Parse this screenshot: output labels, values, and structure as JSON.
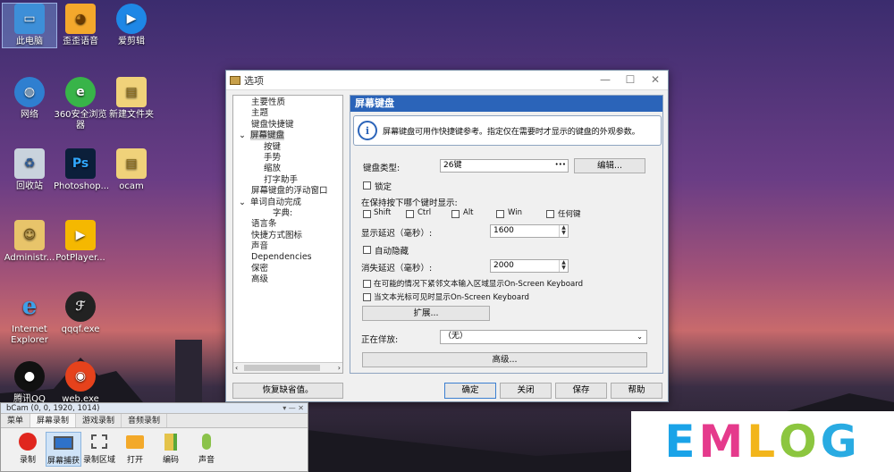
{
  "desktop": {
    "icons": [
      {
        "label": "此电脑"
      },
      {
        "label": "歪歪语音"
      },
      {
        "label": "爱剪辑"
      },
      {
        "label": "网络"
      },
      {
        "label": "360安全浏览器"
      },
      {
        "label": "新建文件夹"
      },
      {
        "label": "回收站"
      },
      {
        "label": "Photoshop..."
      },
      {
        "label": "ocam"
      },
      {
        "label": "Administr..."
      },
      {
        "label": "PotPlayer..."
      },
      {
        "label": "Internet Explorer"
      },
      {
        "label": "qqqf.exe"
      },
      {
        "label": "腾讯QQ"
      },
      {
        "label": "web.exe"
      }
    ]
  },
  "dialog": {
    "title": "选项",
    "tree": [
      "主要性质",
      "主题",
      "键盘快捷键",
      "屏幕键盘",
      "按键",
      "手势",
      "缩放",
      "打字助手",
      "屏幕键盘的浮动窗口",
      "单词自动完成",
      "字典:",
      "语言条",
      "快捷方式图标",
      "声音",
      "Dependencies",
      "保密",
      "高级"
    ],
    "panel_title": "屏幕键盘",
    "info_text": "屏幕键盘可用作快捷键参考。指定仅在需要时才显示的键盘的外观参数。",
    "keyboard_type_label": "键盘类型:",
    "keyboard_type_value": "26键",
    "ellipsis": "•••",
    "edit_button": "编辑...",
    "lock_label": "锁定",
    "hold_label": "在保持按下哪个键时显示:",
    "keys": [
      "Shift",
      "Ctrl",
      "Alt",
      "Win",
      "任何键"
    ],
    "show_delay_label": "显示延迟（毫秒）:",
    "show_delay_value": "1600",
    "auto_hide_label": "自动隐藏",
    "hide_delay_label": "消失延迟（毫秒）:",
    "hide_delay_value": "2000",
    "option1": "在可能的情况下紧邻文本输入区域显示On-Screen Keyboard",
    "option2": "当文本光标可见时显示On-Screen Keyboard",
    "expand_button": "扩展...",
    "playing_label": "正在佯放:",
    "playing_value": "（无）",
    "advanced_button": "高级...",
    "restore_button": "恢复缺省值。",
    "ok_button": "确定",
    "close_button": "关闭",
    "save_button": "保存",
    "help_button": "帮助"
  },
  "recorder": {
    "title": "bCam (0, 0, 1920, 1014)",
    "tabs": [
      "菜单",
      "屏幕录制",
      "游戏录制",
      "音频录制"
    ],
    "tools": [
      "录制",
      "屏幕捕获",
      "录制区域",
      "打开",
      "编码",
      "声音"
    ]
  },
  "watermark": {
    "letters": [
      "E",
      "M",
      "L",
      "O",
      "G"
    ],
    "colors": [
      "#1aa3e8",
      "#e53a8c",
      "#f2b51b",
      "#8cc63f",
      "#29abe2"
    ]
  }
}
